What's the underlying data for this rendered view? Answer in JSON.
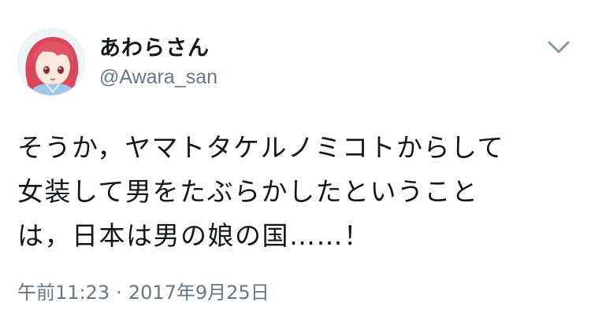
{
  "author": {
    "display_name": "あわらさん",
    "handle": "@Awara_san",
    "avatar_icon": "user-avatar-illustration",
    "caret_icon": "chevron-down-icon"
  },
  "tweet": {
    "lines": [
      "そうか，ヤマトタケルノミコトからして",
      "女装して男をたぶらかしたということ",
      "は，日本は男の娘の国……！"
    ],
    "time": "午前11:23",
    "separator": "·",
    "date": "2017年9月25日"
  },
  "colors": {
    "text": "#14171a",
    "secondary": "#657786",
    "background": "#ffffff"
  }
}
